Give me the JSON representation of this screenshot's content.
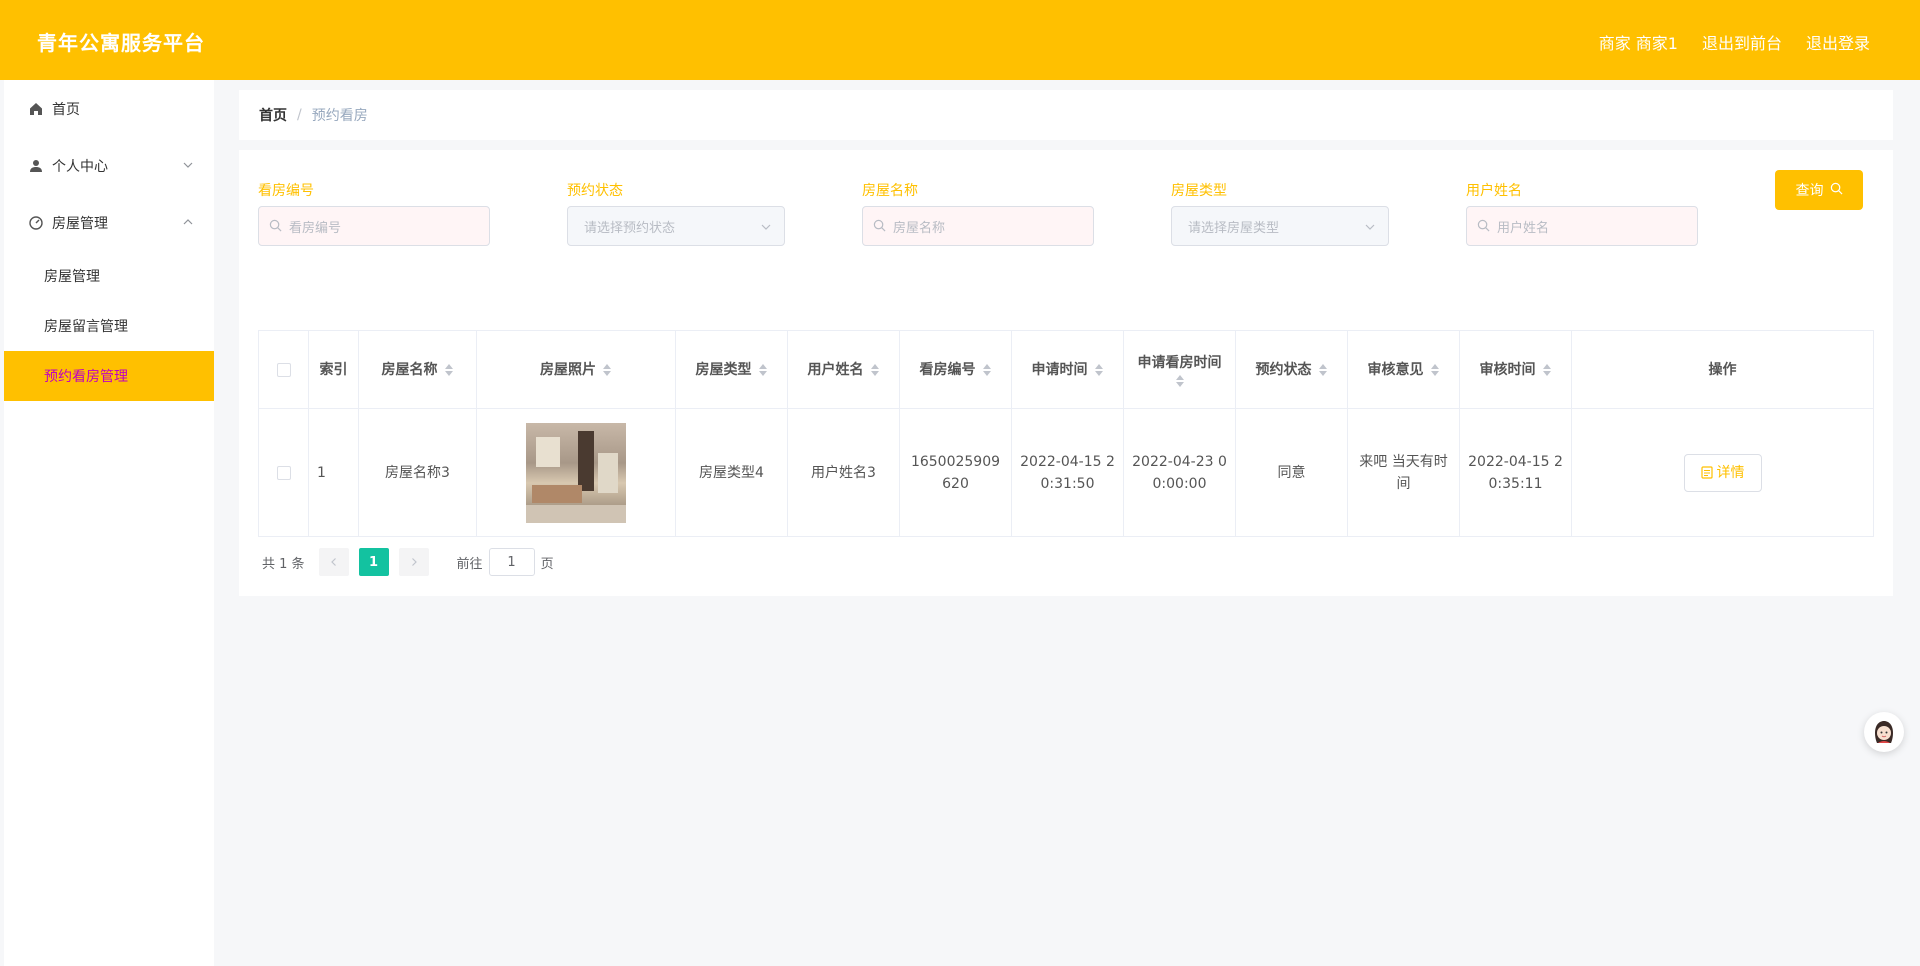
{
  "header": {
    "title": "青年公寓服务平台",
    "user": "商家 商家1",
    "to_front": "退出到前台",
    "logout": "退出登录"
  },
  "sidebar": {
    "home": "首页",
    "personal": "个人中心",
    "house_mgmt": "房屋管理",
    "sub_items": [
      "房屋管理",
      "房屋留言管理",
      "预约看房管理"
    ]
  },
  "breadcrumb": {
    "home": "首页",
    "separator": "/",
    "current": "预约看房"
  },
  "filters": {
    "view_no": {
      "label": "看房编号",
      "placeholder": "看房编号"
    },
    "status": {
      "label": "预约状态",
      "placeholder": "请选择预约状态"
    },
    "house_name": {
      "label": "房屋名称",
      "placeholder": "房屋名称"
    },
    "house_type": {
      "label": "房屋类型",
      "placeholder": "请选择房屋类型"
    },
    "user_name": {
      "label": "用户姓名",
      "placeholder": "用户姓名"
    },
    "search_label": "查询"
  },
  "table": {
    "headers": [
      "索引",
      "房屋名称",
      "房屋照片",
      "房屋类型",
      "用户姓名",
      "看房编号",
      "申请时间",
      "申请看房时间",
      "预约状态",
      "审核意见",
      "审核时间",
      "操作"
    ],
    "rows": [
      {
        "index": "1",
        "house_name": "房屋名称3",
        "house_type": "房屋类型4",
        "user_name": "用户姓名3",
        "view_no": "1650025909620",
        "apply_time": "2022-04-15 20:31:50",
        "view_time": "2022-04-23 00:00:00",
        "status": "同意",
        "review": "来吧 当天有时间",
        "review_time": "2022-04-15 20:35:11",
        "action": "详情"
      }
    ]
  },
  "pagination": {
    "total": "共 1 条",
    "current": "1",
    "goto_label": "前往",
    "goto_value": "1",
    "page_suffix": "页"
  },
  "colors": {
    "brand": "#ffc000",
    "active_text": "#c000c0",
    "page_active": "#13c2a0"
  }
}
